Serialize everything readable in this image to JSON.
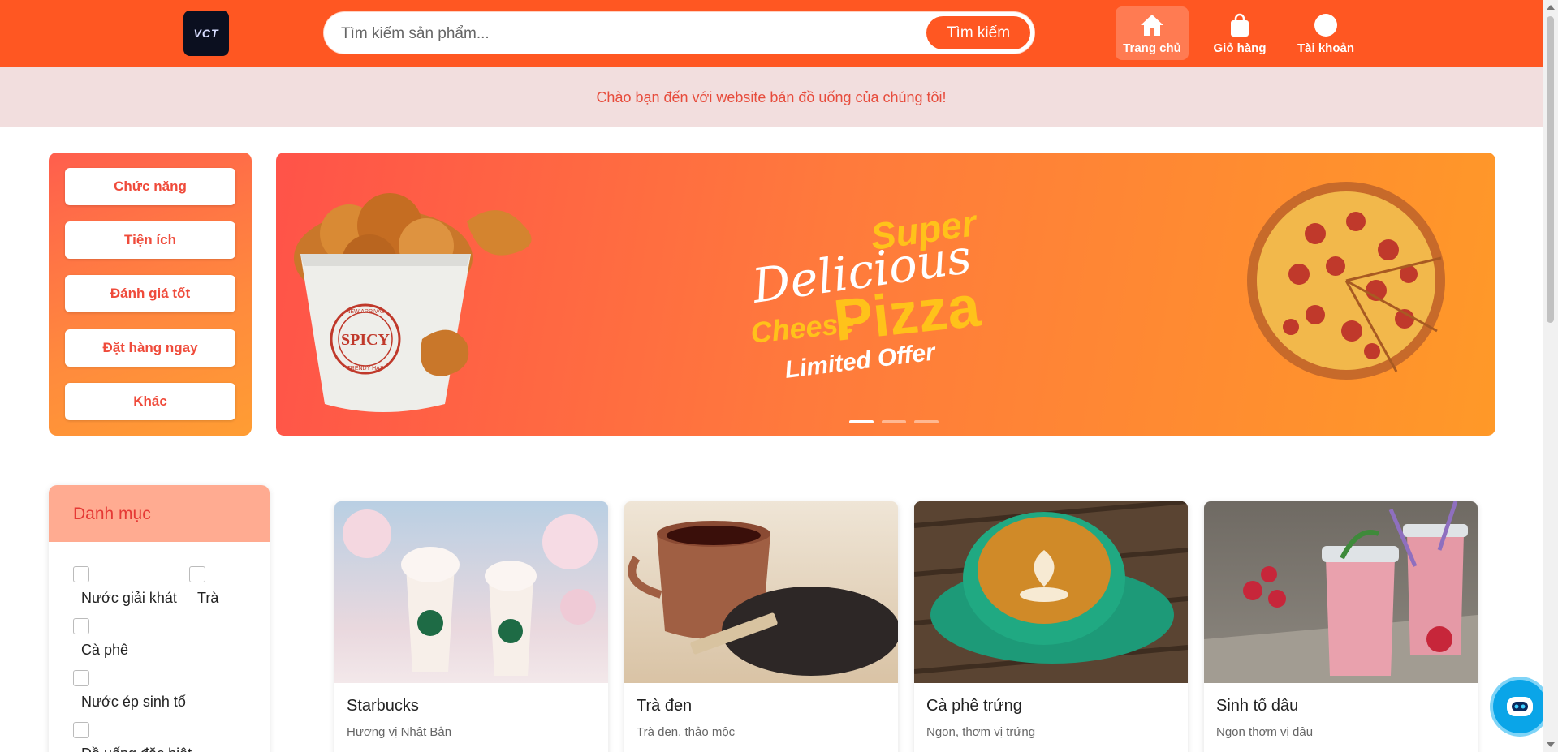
{
  "header": {
    "logo_text": "VCT",
    "search": {
      "placeholder": "Tìm kiếm sản phẩm...",
      "button_label": "Tìm kiếm"
    },
    "nav": [
      {
        "label": "Trang chủ",
        "icon": "home-icon",
        "active": true
      },
      {
        "label": "Giỏ hàng",
        "icon": "shopping-bag-icon",
        "active": false
      },
      {
        "label": "Tài khoản",
        "icon": "user-circle-icon",
        "active": false
      }
    ]
  },
  "welcome_text": "Chào bạn đến với website bán đồ uống của chúng tôi!",
  "functions": [
    "Chức năng",
    "Tiện ích",
    "Đánh giá tốt",
    "Đặt hàng ngay",
    "Khác"
  ],
  "banner": {
    "bucket_label": "SPICY",
    "bucket_ring_top": "NEW ARRIVAL",
    "bucket_ring_bottom": "TRENDY HAS",
    "line_super": "Super",
    "line_delicious": "Delicious",
    "line_cheese": "Cheese",
    "line_pizza": "Pizza",
    "line_offer": "Limited Offer",
    "slide_count": 3,
    "active_slide": 1
  },
  "categories": {
    "title": "Danh mục",
    "options": [
      "Nước giải khát",
      "Trà",
      "Cà phê",
      "Nước ép sinh tố",
      "Đồ uống đặc biệt"
    ]
  },
  "products": [
    {
      "name": "Starbucks",
      "desc": "Hương vị Nhật Bản"
    },
    {
      "name": "Trà đen",
      "desc": "Trà đen, thảo mộc"
    },
    {
      "name": "Cà phê trứng",
      "desc": "Ngon, thơm vị trứng"
    },
    {
      "name": "Sinh tố dâu",
      "desc": "Ngon thơm vị dâu"
    }
  ],
  "colors": {
    "primary": "#ff5722",
    "welcome_bg": "#f2dede",
    "welcome_text": "#e74c3c",
    "category_head": "#ffab91"
  }
}
